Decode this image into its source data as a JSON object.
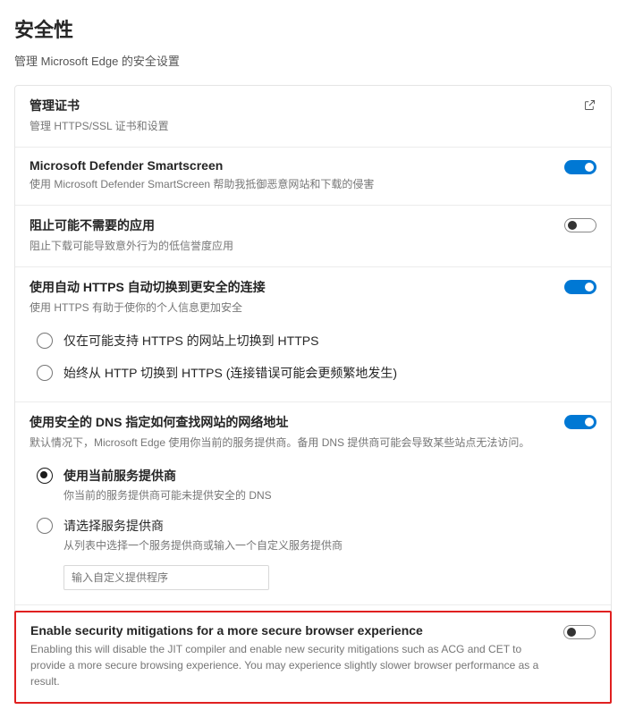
{
  "header": {
    "title": "安全性",
    "subtitle": "管理 Microsoft Edge 的安全设置"
  },
  "rows": {
    "certs": {
      "title": "管理证书",
      "desc": "管理 HTTPS/SSL 证书和设置"
    },
    "smartscreen": {
      "title": "Microsoft Defender Smartscreen",
      "desc": "使用 Microsoft Defender SmartScreen 帮助我抵御恶意网站和下载的侵害",
      "on": true
    },
    "pua": {
      "title": "阻止可能不需要的应用",
      "desc": "阻止下载可能导致意外行为的低信誉度应用",
      "on": false
    },
    "https": {
      "title": "使用自动 HTTPS 自动切换到更安全的连接",
      "desc": "使用 HTTPS 有助于使你的个人信息更加安全",
      "on": true,
      "options": [
        {
          "label": "仅在可能支持 HTTPS 的网站上切换到 HTTPS",
          "sub": "",
          "selected": false
        },
        {
          "label": "始终从 HTTP 切换到 HTTPS (连接错误可能会更频繁地发生)",
          "sub": "",
          "selected": false
        }
      ]
    },
    "dns": {
      "title": "使用安全的 DNS 指定如何查找网站的网络地址",
      "desc": "默认情况下，Microsoft Edge 使用你当前的服务提供商。备用 DNS 提供商可能会导致某些站点无法访问。",
      "on": true,
      "options": [
        {
          "label": "使用当前服务提供商",
          "sub": "你当前的服务提供商可能未提供安全的 DNS",
          "selected": true,
          "bold": true
        },
        {
          "label": "请选择服务提供商",
          "sub": "从列表中选择一个服务提供商或输入一个自定义服务提供商",
          "selected": false
        }
      ],
      "custom_placeholder": "输入自定义提供程序"
    },
    "mitigations": {
      "title": "Enable security mitigations for a more secure browser experience",
      "desc": "Enabling this will disable the JIT compiler and enable new security mitigations such as ACG and CET to provide a more secure browsing experience. You may experience slightly slower browser performance as a result.",
      "on": false
    }
  }
}
